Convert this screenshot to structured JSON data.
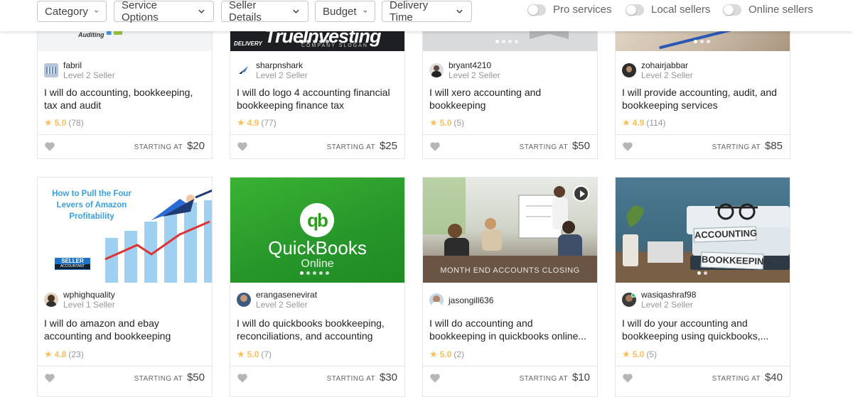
{
  "filters": {
    "category": "Category",
    "service_options": "Service Options",
    "seller_details": "Seller Details",
    "budget": "Budget",
    "delivery_time": "Delivery Time"
  },
  "toggles": {
    "pro": "Pro services",
    "local": "Local sellers",
    "online": "Online sellers"
  },
  "starting_label": "STARTING AT",
  "top_row": [
    {
      "seller": "fabril",
      "level": "Level 2 Seller",
      "title": "I will do accounting, bookkeeping, tax and audit",
      "score": "5.0",
      "count": "(78)",
      "price": "$20",
      "thumb_text": "Auditing"
    },
    {
      "seller": "sharpnshark",
      "level": "Level 2 Seller",
      "title": "I will do logo 4 accounting financial bookkeeping finance tax",
      "score": "4.9",
      "count": "(77)",
      "price": "$25",
      "thumb_text": "TrueInvesting",
      "thumb_sub": "COMPANY SLOGAN",
      "thumb_tag": "DELIVERY"
    },
    {
      "seller": "bryant4210",
      "level": "Level 2 Seller",
      "title": "I will xero accounting and bookkeeping",
      "score": "5.0",
      "count": "(5)",
      "price": "$50"
    },
    {
      "seller": "zohairjabbar",
      "level": "Level 2 Seller",
      "title": "I will provide accounting, audit, and bookkeeping services",
      "score": "4.9",
      "count": "(114)",
      "price": "$85"
    }
  ],
  "bottom_row": [
    {
      "seller": "wphighquality",
      "level": "Level 1 Seller",
      "title": "I will do amazon and ebay accounting and bookkeeping",
      "score": "4.8",
      "count": "(23)",
      "price": "$50",
      "thumb_text": "How to Pull the Four Levers of Amazon Profitability",
      "thumb_badge": "SELLER",
      "thumb_badge_sub": "ACCOUNTANT"
    },
    {
      "seller": "erangasenevirat",
      "level": "Level 2 Seller",
      "title": "I will do quickbooks bookkeeping, reconciliations, and accounting",
      "score": "5.0",
      "count": "(7)",
      "price": "$30",
      "thumb_text": "QuickBooks",
      "thumb_sub": "Online",
      "thumb_logo": "qb"
    },
    {
      "seller": "jasongill636",
      "level": "",
      "title": "I will do accounting and bookkeeping in quickbooks online...",
      "score": "5.0",
      "count": "(2)",
      "price": "$10",
      "thumb_text": "MONTH END ACCOUNTS CLOSING"
    },
    {
      "seller": "wasiqashraf98",
      "level": "Level 2 Seller",
      "title": "I will do your accounting and bookkeeping using quickbooks,...",
      "score": "5.0",
      "count": "(5)",
      "price": "$40",
      "thumb_text": "ACCOUNTING",
      "thumb_sub": "BOOKKEEPING"
    }
  ],
  "colors": {
    "star": "#ffbe5b",
    "quickbooks_green": "#2ca01c"
  }
}
